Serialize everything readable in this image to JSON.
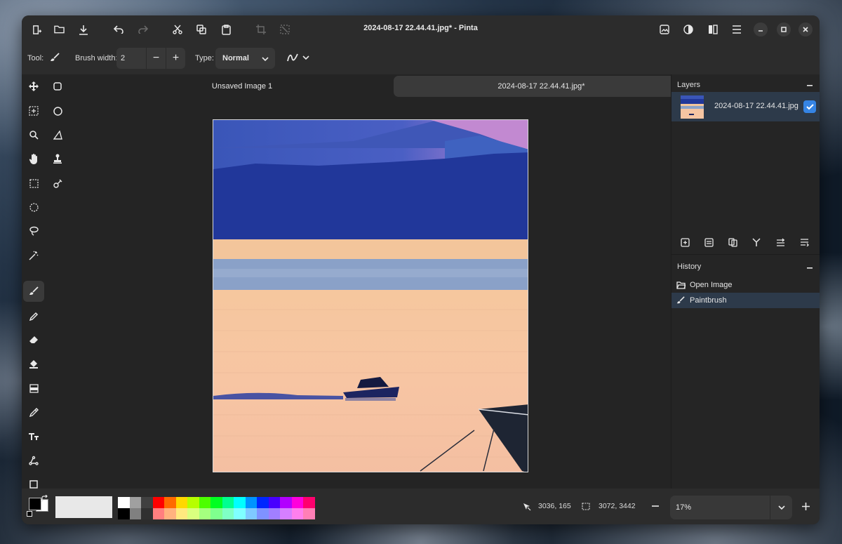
{
  "window": {
    "title": "2024-08-17 22.44.41.jpg* - Pinta"
  },
  "toolbar": {
    "tool_label": "Tool:",
    "brush_width_label": "Brush width:",
    "brush_width_value": "2",
    "type_label": "Type:",
    "type_value": "Normal"
  },
  "tabs": [
    {
      "label": "Unsaved Image 1",
      "active": false
    },
    {
      "label": "2024-08-17 22.44.41.jpg*",
      "active": true
    }
  ],
  "layers": {
    "title": "Layers",
    "items": [
      {
        "name": "2024-08-17 22.44.41.jpg",
        "visible": true
      }
    ]
  },
  "history": {
    "title": "History",
    "items": [
      {
        "label": "Open Image",
        "icon": "folder-open-icon",
        "selected": false
      },
      {
        "label": "Paintbrush",
        "icon": "paintbrush-icon",
        "selected": true
      }
    ]
  },
  "status": {
    "cursor_position": "3036, 165",
    "selection_size": "3072, 3442",
    "zoom": "17%"
  },
  "palette": {
    "primary": "#000000",
    "secondary": "#ffffff",
    "recent": "#e8e8e8",
    "top_row": [
      "#ffffff",
      "#a0a0a0",
      "#404040",
      "#ff0000",
      "#ff6a00",
      "#ffd800",
      "#b6ff00",
      "#4cff00",
      "#00ff21",
      "#00ff90",
      "#00ffff",
      "#0094ff",
      "#0026ff",
      "#4800ff",
      "#b200ff",
      "#ff00dc",
      "#ff006e"
    ],
    "bottom_row": [
      "#000000",
      "#808080",
      "#303030",
      "#ff7f7f",
      "#ffb27f",
      "#ffe97f",
      "#daff7f",
      "#a5ff7f",
      "#7fff8e",
      "#7fffc5",
      "#7fffff",
      "#7fc9ff",
      "#7f92ff",
      "#a17fff",
      "#d67fff",
      "#ff7fed",
      "#ff7fb6"
    ]
  },
  "colors": {
    "accent": "#3584e4",
    "window_bg": "#242424",
    "header_bg": "#2c2c2c"
  }
}
